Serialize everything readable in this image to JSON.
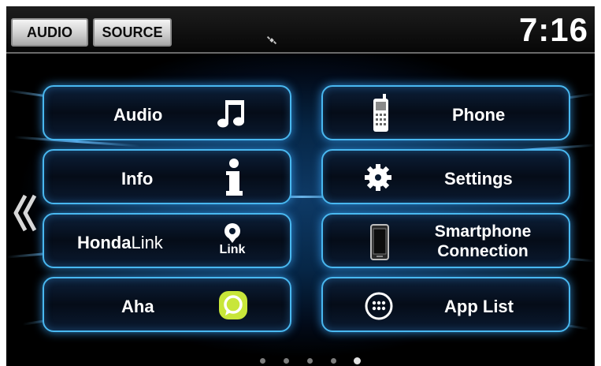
{
  "header": {
    "audio_button": "AUDIO",
    "source_button": "SOURCE",
    "clock": "7:16",
    "status_icon": "gps-satellite-icon"
  },
  "menu": {
    "left": [
      {
        "label": "Audio",
        "icon": "music-note-icon"
      },
      {
        "label": "Info",
        "icon": "info-icon"
      },
      {
        "label_brand": "Honda",
        "label_suffix": "Link",
        "icon": "hondalink-icon",
        "icon_text": "Link"
      },
      {
        "label": "Aha",
        "icon": "aha-icon"
      }
    ],
    "right": [
      {
        "label": "Phone",
        "icon": "mobile-phone-icon"
      },
      {
        "label": "Settings",
        "icon": "gear-icon"
      },
      {
        "label_line1": "Smartphone",
        "label_line2": "Connection",
        "icon": "smartphone-icon"
      },
      {
        "label": "App List",
        "icon": "app-grid-icon"
      }
    ]
  },
  "navigation": {
    "back_icon": "double-chevron-left-icon"
  },
  "pagination": {
    "pages": 5,
    "current_page": 5
  },
  "colors": {
    "tile_border": "#49b8f0",
    "background_glow": "#0e3a66",
    "aha_green": "#c8e63a"
  }
}
